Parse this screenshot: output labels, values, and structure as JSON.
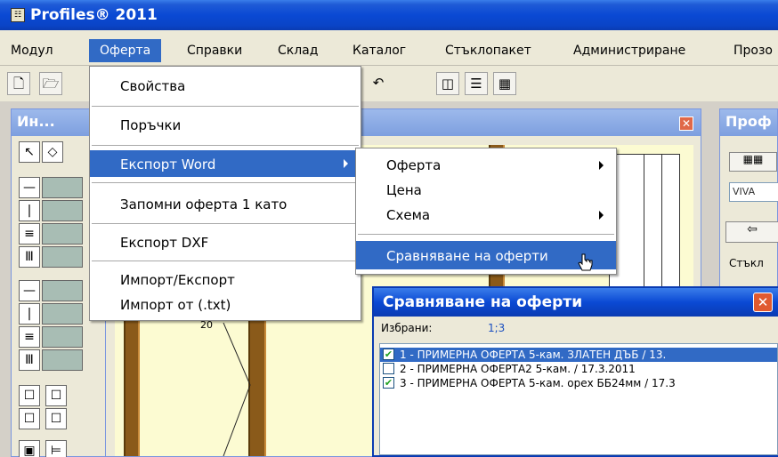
{
  "window": {
    "title": "Profiles® 2011",
    "icon": "app-icon"
  },
  "menubar": {
    "items": [
      {
        "label": "Модул"
      },
      {
        "label": "Оферта"
      },
      {
        "label": "Справки"
      },
      {
        "label": "Склад"
      },
      {
        "label": "Каталог"
      },
      {
        "label": "Стъклопакет"
      },
      {
        "label": "Администриране"
      },
      {
        "label": "Прозо"
      }
    ],
    "active": "Оферта"
  },
  "toolbar": {
    "icons": [
      "new-icon",
      "open-icon",
      "undo-icon",
      "view-icon",
      "lines-icon",
      "grid-icon"
    ],
    "glyphs": [
      "🗋",
      "🗁",
      "↶",
      "◫",
      "☰",
      "▦"
    ]
  },
  "left_panel": {
    "title": "Ин..."
  },
  "right_panel": {
    "title": "Проф",
    "field": "VIVA",
    "group_label": "Стъкл"
  },
  "dropdown": {
    "items": [
      {
        "label": "Свойства"
      },
      {
        "label": "Поръчки"
      },
      {
        "label": "Експорт Word",
        "submenu": true,
        "highlighted": true
      },
      {
        "label": "Запомни оферта  1 като"
      },
      {
        "label": "Експорт DXF"
      },
      {
        "label": "Импорт/Експорт"
      },
      {
        "label": "Импорт от (.txt)"
      }
    ]
  },
  "submenu": {
    "items": [
      {
        "label": "Оферта",
        "submenu": true
      },
      {
        "label": "Цена"
      },
      {
        "label": "Схема",
        "submenu": true
      },
      {
        "label": "Сравняване на оферти",
        "highlighted": true
      }
    ]
  },
  "dialog": {
    "title": "Сравняване на оферти",
    "selected_label": "Избрани:",
    "selected_value": "1;3",
    "rows": [
      {
        "text": "1 - ПРИМЕРНА ОФЕРТА 5-кам. ЗЛАТЕН ДЪБ / 13.",
        "checked": true,
        "highlighted": true
      },
      {
        "text": "2 - ПРИМЕРНА ОФЕРТА2 5-кам. / 17.3.2011",
        "checked": false,
        "highlighted": false
      },
      {
        "text": "3 - ПРИМЕРНА ОФЕРТА 5-кам. орех ББ24мм / 17.3",
        "checked": true,
        "highlighted": false
      }
    ]
  },
  "canvas": {
    "dimension_label": "20"
  },
  "colors": {
    "highlight": "#316ac5",
    "titlebar": "#0a49d4",
    "frame": "#8a5a1a"
  }
}
